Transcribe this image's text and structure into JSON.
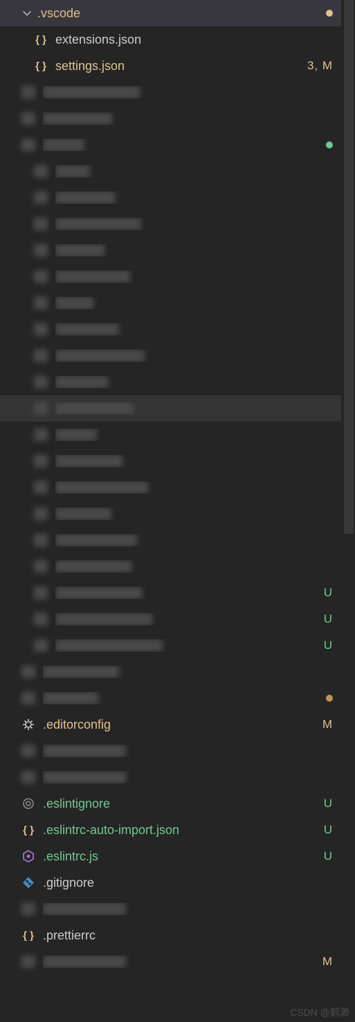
{
  "folder": {
    "name": ".vscode",
    "statusDot": "yellow",
    "children": [
      {
        "name": "extensions.json",
        "icon": "json",
        "color": "gray",
        "badge": "",
        "dot": ""
      },
      {
        "name": "settings.json",
        "icon": "json",
        "color": "yellow",
        "badge": "3, M",
        "dot": ""
      }
    ]
  },
  "blurred": {
    "section1": {
      "rows": 2
    },
    "section2": {
      "header_dot": "green",
      "children": 15,
      "highlight_index": 9
    },
    "greenFiles": [
      {
        "badge": ""
      },
      {
        "badge": "U"
      },
      {
        "badge": "U"
      },
      {
        "badge": "U"
      }
    ],
    "tanFolder": {
      "dot": "tan"
    }
  },
  "rootFiles": [
    {
      "name": ".editorconfig",
      "icon": "gear",
      "color": "yellow",
      "badge": "M"
    },
    {
      "name": "_blur1",
      "icon": "blur",
      "color": "blur",
      "badge": ""
    },
    {
      "name": "_blur2",
      "icon": "blur",
      "color": "blur",
      "badge": ""
    },
    {
      "name": ".eslintignore",
      "icon": "target",
      "color": "green",
      "badge": "U"
    },
    {
      "name": ".eslintrc-auto-import.json",
      "icon": "json",
      "color": "green",
      "badge": "U"
    },
    {
      "name": ".eslintrc.js",
      "icon": "hex",
      "color": "green",
      "badge": "U"
    },
    {
      "name": ".gitignore",
      "icon": "git",
      "color": "gray",
      "badge": ""
    },
    {
      "name": "_blur3",
      "icon": "blur",
      "color": "blur",
      "badge": ""
    },
    {
      "name": ".prettierrc",
      "icon": "json",
      "color": "gray",
      "badge": ""
    },
    {
      "name": "_blur4",
      "icon": "blur",
      "color": "yellow",
      "badge": "M"
    }
  ],
  "watermark": "CSDN @鹤渺"
}
